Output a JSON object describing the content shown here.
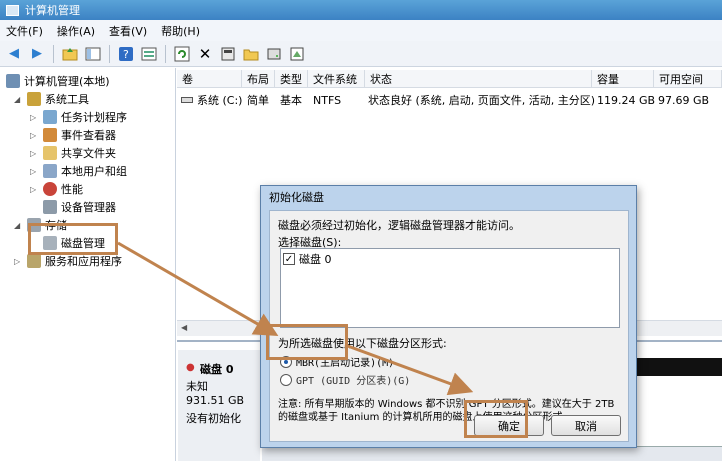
{
  "window": {
    "title": "计算机管理"
  },
  "menu": {
    "file": "文件(F)",
    "action": "操作(A)",
    "view": "查看(V)",
    "help": "帮助(H)"
  },
  "toolbar": {
    "back_icon": "back-arrow-icon",
    "forward_icon": "forward-arrow-icon"
  },
  "tree": {
    "root": "计算机管理(本地)",
    "system_tools": "系统工具",
    "task_scheduler": "任务计划程序",
    "event_viewer": "事件查看器",
    "shared_folders": "共享文件夹",
    "local_users": "本地用户和组",
    "performance": "性能",
    "device_manager": "设备管理器",
    "storage": "存储",
    "disk_management": "磁盘管理",
    "services_apps": "服务和应用程序"
  },
  "volume_table": {
    "headers": [
      "卷",
      "布局",
      "类型",
      "文件系统",
      "状态",
      "容量",
      "可用空间"
    ],
    "rows": [
      [
        "系统 (C:)",
        "简单",
        "基本",
        "NTFS",
        "状态良好 (系统, 启动, 页面文件, 活动, 主分区)",
        "119.24 GB",
        "97.69 GB"
      ]
    ]
  },
  "disk_panel": {
    "name": "磁盘 0",
    "status": "未知",
    "size": "931.51 GB",
    "init": "没有初始化"
  },
  "dialog": {
    "title": "初始化磁盘",
    "intro": "磁盘必须经过初始化，逻辑磁盘管理器才能访问。",
    "select_label": "选择磁盘(S):",
    "disk_item": "磁盘 0",
    "partition_label": "为所选磁盘使用以下磁盘分区形式:",
    "mbr_option": "MBR(主启动记录)(M)",
    "gpt_option": "GPT (GUID 分区表)(G)",
    "note": "注意: 所有早期版本的 Windows 都不识别 GPT 分区形式。建议在大于 2TB 的磁盘或基于 Itanium 的计算机所用的磁盘上使用这种分区形式。",
    "ok": "确定",
    "cancel": "取消"
  },
  "colors": {
    "accent": "#3c82c4",
    "annotation": "#c0834e"
  }
}
